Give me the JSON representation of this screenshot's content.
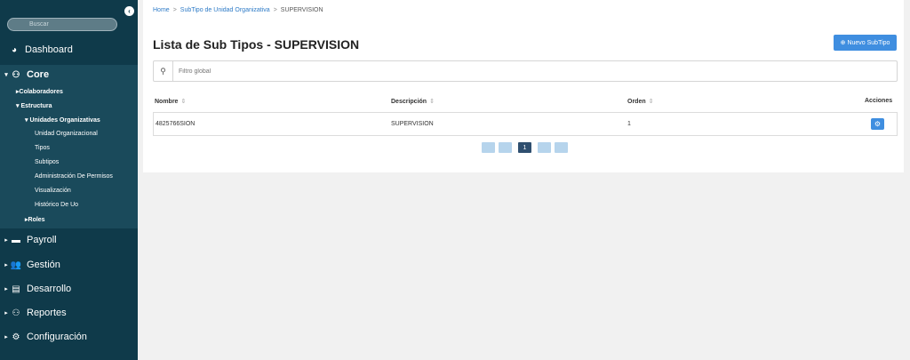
{
  "sidebar": {
    "search_placeholder": "Buscar",
    "collapse_icon": "chevron-left-icon",
    "dashboard": {
      "label": "Dashboard",
      "icon": "dashboard-icon"
    },
    "core": {
      "label": "Core",
      "icon": "sitemap-icon"
    },
    "core_items": {
      "colaboradores": "Colaboradores",
      "estructura": "Estructura",
      "unidades_org": "Unidades Organizativas",
      "unidad_org": "Unidad Organizacional",
      "tipos": "Tipos",
      "subtipos": "Subtipos",
      "admin_permisos": "Administración De Permisos",
      "visualizacion": "Visualización",
      "historico": "Histórico De Uo",
      "roles": "Roles"
    },
    "payroll": {
      "label": "Payroll",
      "icon": "money-icon"
    },
    "gestion": {
      "label": "Gestión",
      "icon": "users-icon"
    },
    "desarrollo": {
      "label": "Desarrollo",
      "icon": "book-icon"
    },
    "reportes": {
      "label": "Reportes",
      "icon": "sitemap-icon"
    },
    "configuracion": {
      "label": "Configuración",
      "icon": "gear-icon"
    }
  },
  "breadcrumb": {
    "home": "Home",
    "sep": ">",
    "subtipo": "SubTipo de Unidad Organizativa",
    "current": "SUPERVISION"
  },
  "page": {
    "title": "Lista de Sub Tipos - SUPERVISION",
    "new_button": "Nuevo SubTipo",
    "filter_placeholder": "Filtro global"
  },
  "table": {
    "headers": {
      "nombre": "Nombre",
      "descripcion": "Descripción",
      "orden": "Orden",
      "acciones": "Acciones"
    },
    "sort_glyph": "⇕",
    "rows": [
      {
        "nombre": "4825766SION",
        "descripcion": "SUPERVISION",
        "orden": "1"
      }
    ]
  },
  "pagination": {
    "current_page": "1"
  },
  "colors": {
    "sidebar": "#0f3a4a",
    "accent": "#3f8ee0",
    "active_page": "#2f4f6f"
  }
}
